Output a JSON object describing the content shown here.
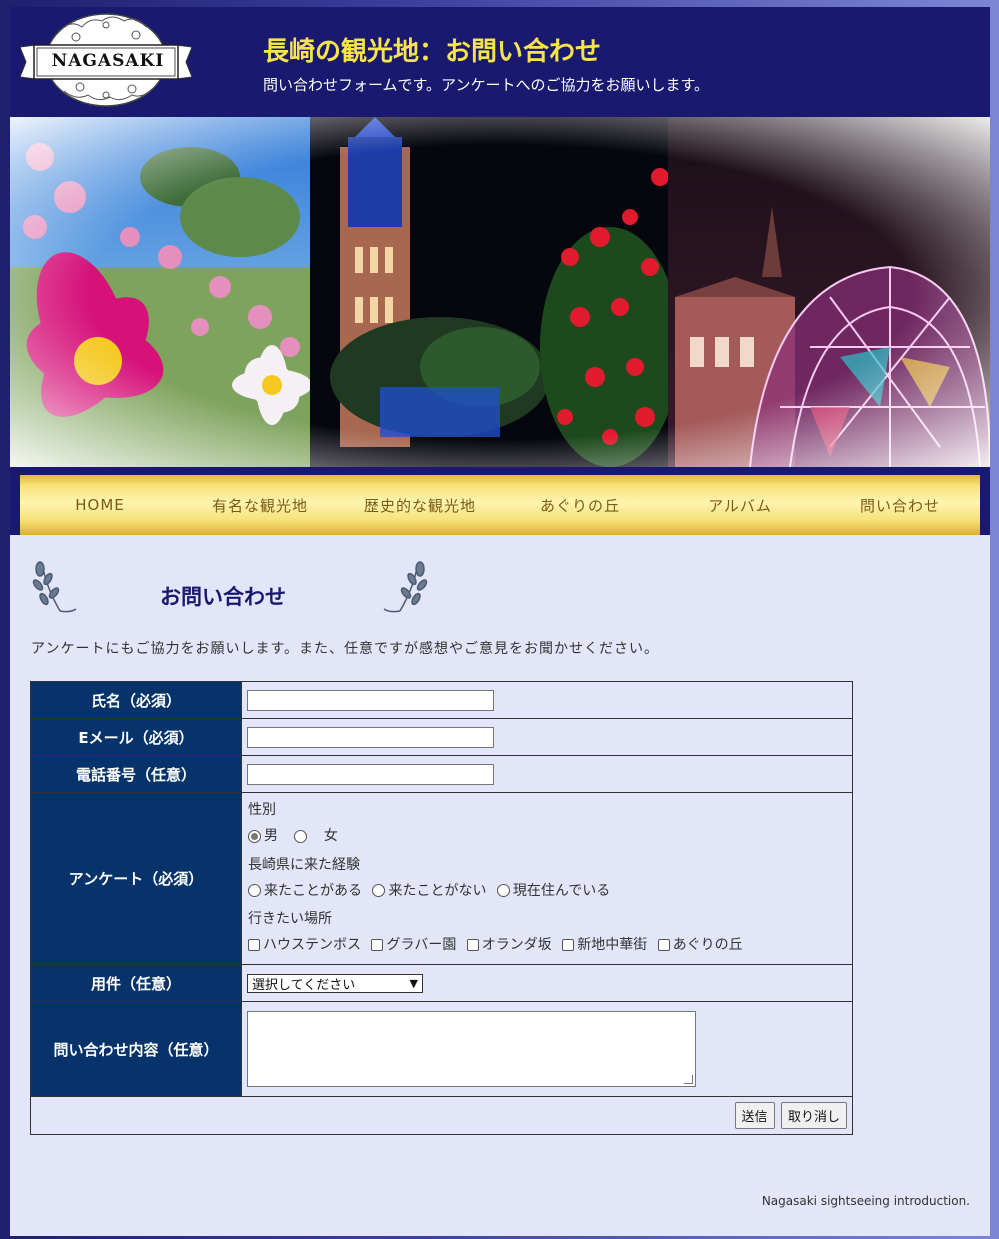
{
  "header": {
    "logo_text": "NAGASAKI",
    "title": "長崎の観光地：お問い合わせ",
    "subtitle": "問い合わせフォームです。アンケートへのご協力をお願いします。"
  },
  "nav": {
    "items": [
      "HOME",
      "有名な観光地",
      "歴史的な観光地",
      "あぐりの丘",
      "アルバム",
      "問い合わせ"
    ]
  },
  "main": {
    "section_title": "お問い合わせ",
    "intro": "アンケートにもご協力をお願いします。また、任意ですが感想やご意見をお聞かせください。"
  },
  "form": {
    "name_label": "氏名（必須）",
    "name_value": "",
    "email_label": "Eメール（必須）",
    "email_value": "",
    "phone_label": "電話番号（任意）",
    "phone_value": "",
    "survey_label": "アンケート（必須）",
    "gender_q": "性別",
    "gender_options": [
      "男",
      "女"
    ],
    "gender_selected": "男",
    "visit_q": "長崎県に来た経験",
    "visit_options": [
      "来たことがある",
      "来たことがない",
      "現在住んでいる"
    ],
    "place_q": "行きたい場所",
    "place_options": [
      "ハウステンボス",
      "グラバー園",
      "オランダ坂",
      "新地中華街",
      "あぐりの丘"
    ],
    "purpose_label": "用件（任意）",
    "purpose_selected": "選択してください",
    "message_label": "問い合わせ内容（任意）",
    "submit": "送信",
    "reset": "取り消し"
  },
  "footer": {
    "note": "Nagasaki sightseeing introduction."
  },
  "colors": {
    "header_bg": "#191970",
    "title_yellow": "#f7e44a",
    "table_header_bg": "#06336a",
    "page_bg": "#e3e5f8",
    "nav_gold": "#f8e37a"
  }
}
